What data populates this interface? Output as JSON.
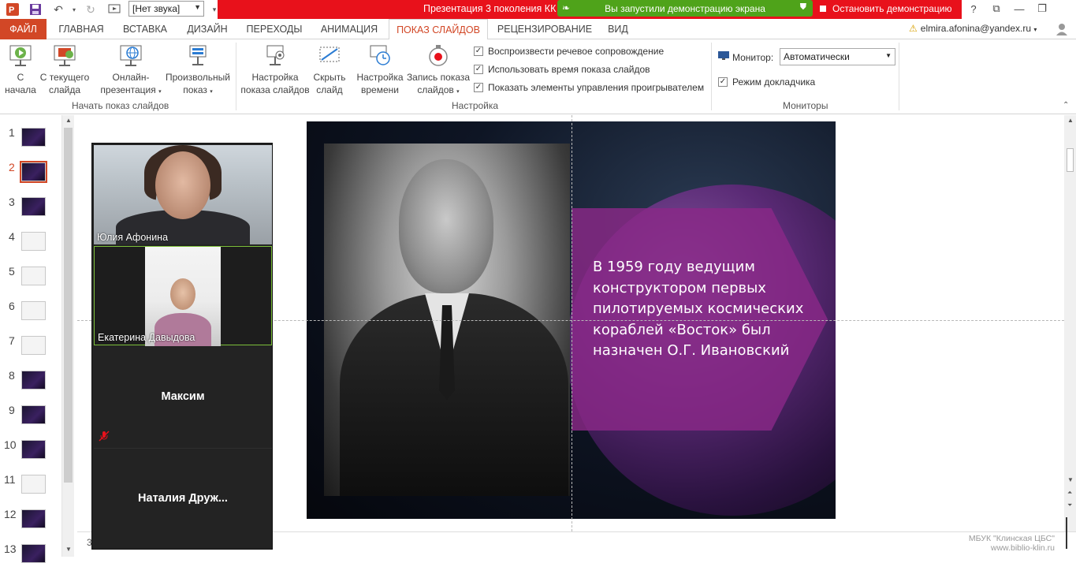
{
  "titlebar": {
    "sound_select": "[Нет звука]",
    "title": "Презентация 3 поколения КК -",
    "share_status": "Вы запустили демонстрацию экрана",
    "stop_share": "Остановить демонстрацию",
    "win_buttons": [
      "?",
      "⧉",
      "—",
      "❐"
    ]
  },
  "tabs": {
    "file": "ФАЙЛ",
    "items": [
      "ГЛАВНАЯ",
      "ВСТАВКА",
      "ДИЗАЙН",
      "ПЕРЕХОДЫ",
      "АНИМАЦИЯ",
      "ПОКАЗ СЛАЙДОВ",
      "РЕЦЕНЗИРОВАНИЕ",
      "ВИД"
    ],
    "active": "ПОКАЗ СЛАЙДОВ",
    "user": "elmira.afonina@yandex.ru"
  },
  "ribbon": {
    "btn_from_start": [
      "С",
      "начала"
    ],
    "btn_from_current": [
      "С текущего",
      "слайда"
    ],
    "btn_online": [
      "Онлайн-",
      "презентация"
    ],
    "btn_custom": [
      "Произвольный",
      "показ"
    ],
    "group_start": "Начать показ слайдов",
    "btn_setup": [
      "Настройка",
      "показа слайдов"
    ],
    "btn_hide": [
      "Скрыть",
      "слайд"
    ],
    "btn_timing": [
      "Настройка",
      "времени"
    ],
    "btn_record": [
      "Запись показа",
      "слайдов"
    ],
    "chk_narration": "Воспроизвести речевое сопровождение",
    "chk_timings": "Использовать время показа слайдов",
    "chk_controls": "Показать элементы управления проигрывателем",
    "group_setup": "Настройка",
    "monitor_label": "Монитор:",
    "monitor_value": "Автоматически",
    "chk_presenter": "Режим докладчика",
    "group_monitors": "Мониторы"
  },
  "thumbnails": {
    "numbers": [
      "1",
      "2",
      "3",
      "4",
      "5",
      "6",
      "7",
      "8",
      "9",
      "10",
      "11",
      "12",
      "13"
    ],
    "active": "2"
  },
  "slide": {
    "text": "В 1959 году ведущим конструктором первых пилотируемых космических кораблей «Восток» был назначен О.Г. Ивановский"
  },
  "zoom": {
    "p1": "Юлия Афонина",
    "p2": "Екатерина Давыдова",
    "p3": "Максим",
    "p4": "Наталия  Друж..."
  },
  "status": {
    "slide_indicator": "3",
    "watermark_1": "МБУК \"Клинская ЦБС\"",
    "watermark_2": "www.biblio-klin.ru"
  },
  "colors": {
    "accent": "#d24726",
    "zoom_red": "#e8111b",
    "zoom_green": "#4fa31a"
  }
}
